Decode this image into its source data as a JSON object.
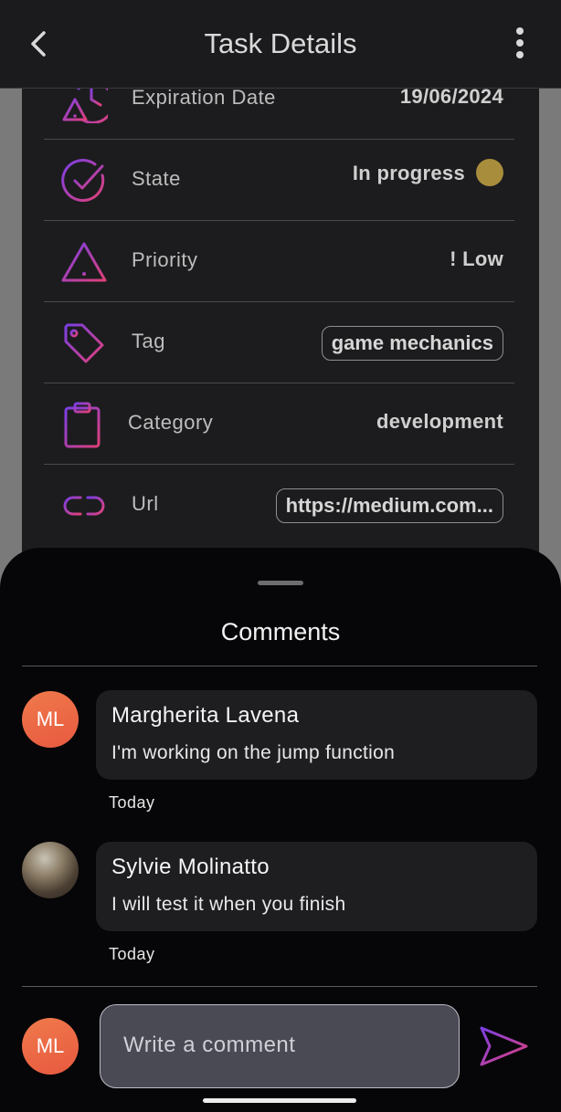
{
  "header": {
    "title": "Task Details",
    "back_icon": "chevron-left-icon",
    "more_icon": "kebab-menu-icon"
  },
  "details": [
    {
      "key": "expiration",
      "icon": "calendar-warning-icon",
      "label": "Expiration Date",
      "value": "19/06/2024"
    },
    {
      "key": "state",
      "icon": "check-circle-icon",
      "label": "State",
      "value": "In progress",
      "status_color": "#a88d3c"
    },
    {
      "key": "priority",
      "icon": "warning-triangle-icon",
      "label": "Priority",
      "value": "! Low"
    },
    {
      "key": "tag",
      "icon": "tag-icon",
      "label": "Tag",
      "value": "game mechanics"
    },
    {
      "key": "category",
      "icon": "clipboard-icon",
      "label": "Category",
      "value": "development"
    },
    {
      "key": "url",
      "icon": "link-icon",
      "label": "Url",
      "value": "https://medium.com..."
    }
  ],
  "comments": {
    "title": "Comments",
    "items": [
      {
        "initials": "ML",
        "author": "Margherita Lavena",
        "text": "I'm working on the jump function",
        "time": "Today"
      },
      {
        "initials": "",
        "author": "Sylvie Molinatto",
        "text": "I will test it when you finish",
        "time": "Today"
      }
    ],
    "composer": {
      "initials": "ML",
      "placeholder": "Write a comment",
      "send_icon": "send-icon"
    }
  },
  "colors": {
    "accent_gradient_start": "#7b3fe4",
    "accent_gradient_end": "#e0407a",
    "avatar": "#ec6b45"
  }
}
